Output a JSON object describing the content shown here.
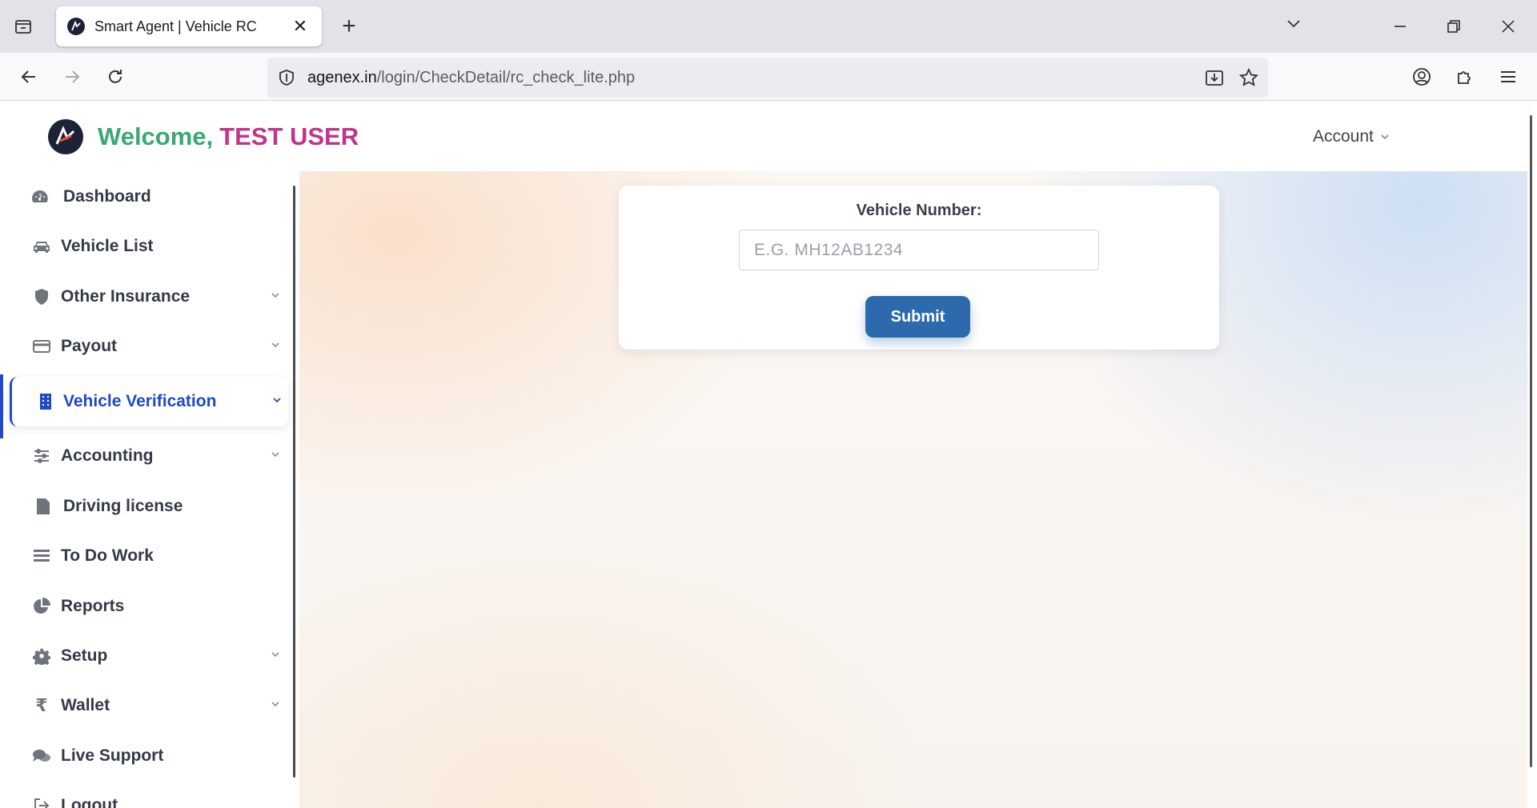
{
  "browser": {
    "tab_title": "Smart Agent | Vehicle RC",
    "url_domain": "agenex.in",
    "url_path": "/login/CheckDetail/rc_check_lite.php"
  },
  "header": {
    "welcome_prefix": "Welcome,",
    "user_name": "TEST USER",
    "account_label": "Account"
  },
  "sidebar": {
    "items": [
      {
        "label": "Dashboard",
        "icon": "dashboard-icon"
      },
      {
        "label": "Vehicle List",
        "icon": "car-icon"
      },
      {
        "label": "Other Insurance",
        "icon": "shield-icon"
      },
      {
        "label": "Payout",
        "icon": "credit-card-icon"
      },
      {
        "label": "Vehicle Verification",
        "icon": "building-icon",
        "active": true
      },
      {
        "label": "Accounting",
        "icon": "sliders-icon"
      },
      {
        "label": "Driving license",
        "icon": "document-icon"
      },
      {
        "label": "To Do Work",
        "icon": "list-icon"
      },
      {
        "label": "Reports",
        "icon": "pie-chart-icon"
      },
      {
        "label": "Setup",
        "icon": "gear-icon"
      },
      {
        "label": "Wallet",
        "icon": "rupee-icon"
      },
      {
        "label": "Live Support",
        "icon": "chat-icon"
      },
      {
        "label": "Logout",
        "icon": "logout-icon"
      }
    ]
  },
  "form": {
    "label": "Vehicle Number:",
    "placeholder": "E.G. MH12AB1234",
    "value": "",
    "submit_label": "Submit"
  },
  "colors": {
    "accent": "#1e49c9",
    "button": "#2d6aad",
    "welcome_green": "#3aa776",
    "welcome_pink": "#c2338a"
  }
}
